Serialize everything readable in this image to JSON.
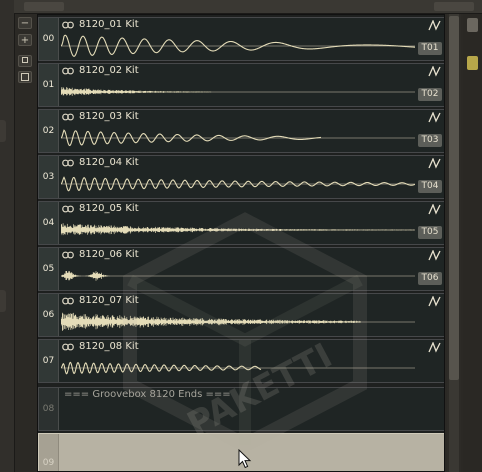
{
  "controls": {
    "collapse_label": "−",
    "expand_label": "+"
  },
  "instruments": [
    {
      "index": "00",
      "name": "8120_01 Kit",
      "track": "T01",
      "wave": "tone-long"
    },
    {
      "index": "01",
      "name": "8120_02 Kit",
      "track": "T02",
      "wave": "noise-short"
    },
    {
      "index": "02",
      "name": "8120_03 Kit",
      "track": "T03",
      "wave": "tone-fast"
    },
    {
      "index": "03",
      "name": "8120_04 Kit",
      "track": "T04",
      "wave": "tone-mid"
    },
    {
      "index": "04",
      "name": "8120_05 Kit",
      "track": "T05",
      "wave": "noise-mid"
    },
    {
      "index": "05",
      "name": "8120_06 Kit",
      "track": "T06",
      "wave": "blip"
    },
    {
      "index": "06",
      "name": "8120_07 Kit",
      "track": "",
      "wave": "noise-long"
    },
    {
      "index": "07",
      "name": "8120_08 Kit",
      "track": "",
      "wave": "tone-small"
    }
  ],
  "end_slot": {
    "index": "08",
    "text": "=== Groovebox 8120 Ends ==="
  },
  "empty_slot": {
    "index": "09"
  },
  "watermark_text": "PAKETTI",
  "colors": {
    "waveform": "#e4dcb8",
    "baseline": "#9a9586",
    "panel": "#1f2524",
    "selected_slot": "#b7b2a3"
  }
}
